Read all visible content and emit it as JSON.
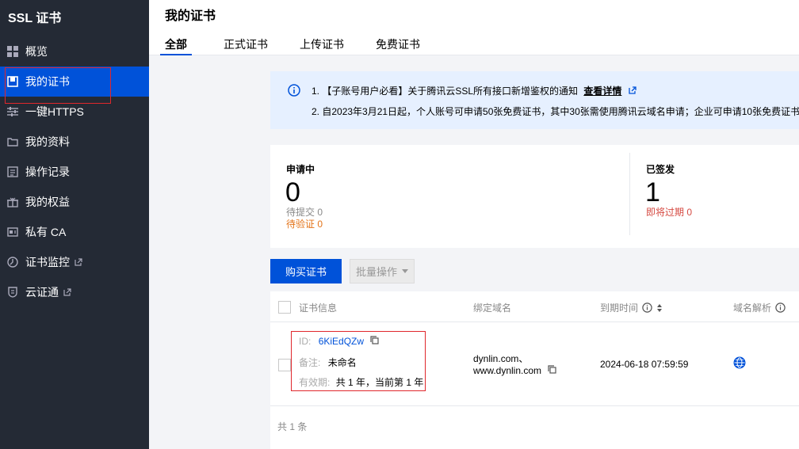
{
  "app": {
    "title": "SSL 证书"
  },
  "sidebar": {
    "items": [
      {
        "label": "概览",
        "icon": "grid-icon"
      },
      {
        "label": "我的证书",
        "icon": "certificate-icon"
      },
      {
        "label": "一键HTTPS",
        "icon": "sliders-icon"
      },
      {
        "label": "我的资料",
        "icon": "folder-icon"
      },
      {
        "label": "操作记录",
        "icon": "log-icon"
      },
      {
        "label": "我的权益",
        "icon": "gift-icon"
      },
      {
        "label": "私有 CA",
        "icon": "ca-icon"
      },
      {
        "label": "证书监控",
        "icon": "monitor-icon"
      },
      {
        "label": "云证通",
        "icon": "shield-icon"
      }
    ]
  },
  "header": {
    "title": "我的证书",
    "tabs": [
      {
        "label": "全部"
      },
      {
        "label": "正式证书"
      },
      {
        "label": "上传证书"
      },
      {
        "label": "免费证书"
      }
    ]
  },
  "notice": {
    "line1": "1. 【子账号用户必看】关于腾讯云SSL所有接口新增鉴权的通知",
    "line1_link": "查看详情",
    "line2": "2. 自2023年3月21日起，个人账号可申请50张免费证书，其中30张需使用腾讯云域名申请；企业可申请10张免费证书"
  },
  "stats": {
    "applying": {
      "label": "申请中",
      "count": "0",
      "pending_submit": "待提交 0",
      "pending_verify": "待验证 0"
    },
    "issued": {
      "label": "已签发",
      "count": "1",
      "expiring": "即将过期 0"
    }
  },
  "toolbar": {
    "buy_label": "购买证书",
    "batch_label": "批量操作"
  },
  "table": {
    "headers": {
      "cert_info": "证书信息",
      "domain": "绑定域名",
      "expiry": "到期时间",
      "dns": "域名解析"
    },
    "rows": [
      {
        "id_label": "ID:",
        "id_value": "6KiEdQZw",
        "note_label": "备注:",
        "note_value": "未命名",
        "validity_label": "有效期:",
        "validity_value": "共 1 年，当前第 1 年",
        "domain_line1": "dynlin.com、",
        "domain_line2": "www.dynlin.com",
        "expiry": "2024-06-18 07:59:59"
      }
    ],
    "footer": "共 1 条"
  },
  "colors": {
    "sidebar_bg": "#242a35",
    "accent": "#0052d9",
    "warning": "#e37318",
    "danger": "#d54941",
    "highlight_box": "#e0272c"
  }
}
